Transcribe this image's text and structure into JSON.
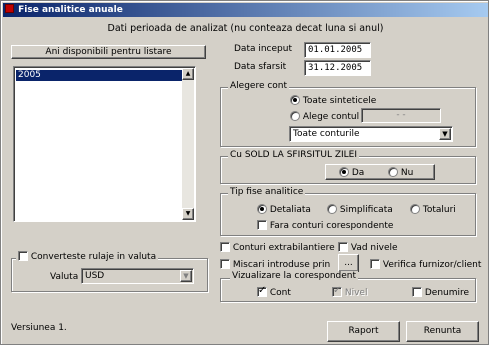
{
  "window": {
    "title": "Fise analitice anuale"
  },
  "header": {
    "text": "Dati perioada de analizat (nu conteaza decat luna si anul)"
  },
  "years_panel": {
    "title": "Ani disponibili pentru listare",
    "items": [
      "2005"
    ]
  },
  "dates": {
    "start_label": "Data inceput",
    "start_value": "01.01.2005",
    "end_label": "Data sfarsit",
    "end_value": "31.12.2005"
  },
  "account_group": {
    "title": "Alegere cont",
    "option_synthetic": "Toate sinteticele",
    "option_choose": "Alege contul",
    "account_mask": "- -",
    "accounts_select": "Toate conturile"
  },
  "sold_group": {
    "title": "Cu SOLD LA SFIRSITUL ZILEI",
    "yes": "Da",
    "no": "Nu"
  },
  "type_group": {
    "title": "Tip fise analitice",
    "detailed": "Detaliata",
    "simplified": "Simplificata",
    "totals": "Totaluri",
    "no_correspondents": "Fara conturi corespondente"
  },
  "options": {
    "off_balance": "Conturi extrabilantiere",
    "see_levels": "Vad nivele",
    "entries_by": "Miscari introduse prin",
    "entries_btn": "...",
    "check_partner": "Verifica furnizor/client"
  },
  "correspondent_group": {
    "title": "Vizualizare la corespondent",
    "account": "Cont",
    "level": "Nivel",
    "name": "Denumire"
  },
  "currency": {
    "convert_label": "Converteste rulaje in valuta",
    "currency_label": "Valuta",
    "currency_value": "USD"
  },
  "footer": {
    "version": "Versiunea 1.",
    "report_btn": "Raport",
    "cancel_btn": "Renunta"
  }
}
